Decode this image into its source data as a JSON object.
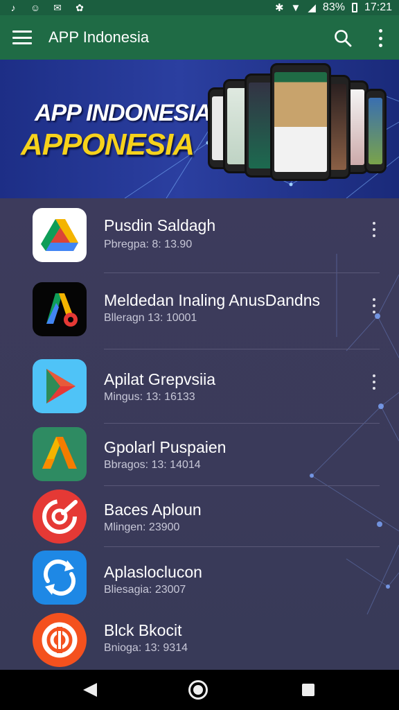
{
  "status_bar": {
    "battery": "83%",
    "time": "17:21",
    "left_icons": [
      "notification-icon-1",
      "notification-icon-2",
      "notification-icon-3",
      "notification-icon-4"
    ],
    "right_icons": [
      "bluetooth-icon",
      "wifi-icon",
      "signal-icon"
    ]
  },
  "app_bar": {
    "title": "APP Indonesia",
    "icons": [
      "menu-icon",
      "search-icon",
      "more-vert-icon"
    ],
    "color": "#1f6b45"
  },
  "banner": {
    "line1": "APP INDONESIA",
    "line2": "APPONESIA",
    "accent": "#f6d21c"
  },
  "apps": [
    {
      "name": "Pusdin Saldagh",
      "meta": "Pbregpa: 8: 13.90",
      "icon": "drive-like-icon"
    },
    {
      "name": "Meldedan Inaling AnusDandns",
      "meta": "Blleragn 13: 10001",
      "icon": "ads-like-icon"
    },
    {
      "name": "Apilat Grepvsiia",
      "meta": "Mingus: 13: 16133",
      "icon": "play-icon"
    },
    {
      "name": "Gpolarl Puspaien",
      "meta": "Bbragos: 13: 14014",
      "icon": "a-logo-icon"
    },
    {
      "name": "Baces Aploun",
      "meta": "Mlingen: 23900",
      "icon": "target-icon"
    },
    {
      "name": "Aplasloclucon",
      "meta": "Bliesagia: 23007",
      "icon": "sync-icon"
    },
    {
      "name": "Blck Bkocit",
      "meta": "Bnioga: 13: 9314",
      "icon": "lock-ring-icon"
    }
  ],
  "nav_bar": {
    "icons": [
      "back-icon",
      "home-icon",
      "recents-icon"
    ]
  }
}
